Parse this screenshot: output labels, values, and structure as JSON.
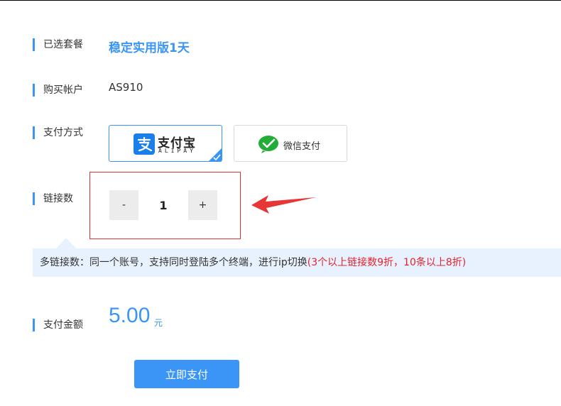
{
  "package": {
    "label": "已选套餐",
    "value": "稳定实用版1天"
  },
  "account": {
    "label": "购买帐户",
    "value": "AS910"
  },
  "payment_method": {
    "label": "支付方式",
    "selected": "alipay",
    "options": [
      {
        "id": "alipay",
        "name": "支付宝",
        "subtitle": "ALIPAY",
        "icon": "alipay-icon"
      },
      {
        "id": "wechat",
        "name": "微信支付",
        "icon": "wechat-pay-icon"
      }
    ]
  },
  "connections": {
    "label": "链接数",
    "value": "1",
    "decrement_label": "-",
    "increment_label": "+"
  },
  "notice": {
    "text": "多链接数：同一个账号，支持同时登陆多个终端，进行ip切换",
    "discount": "(3个以上链接数9折，10条以上8折)"
  },
  "amount": {
    "label": "支付金额",
    "value": "5.00",
    "currency": "元"
  },
  "submit": {
    "label": "立即支付"
  },
  "colors": {
    "accent": "#3b95f7",
    "annotation_red": "#e03434",
    "notice_bg": "#e7f2fe"
  }
}
